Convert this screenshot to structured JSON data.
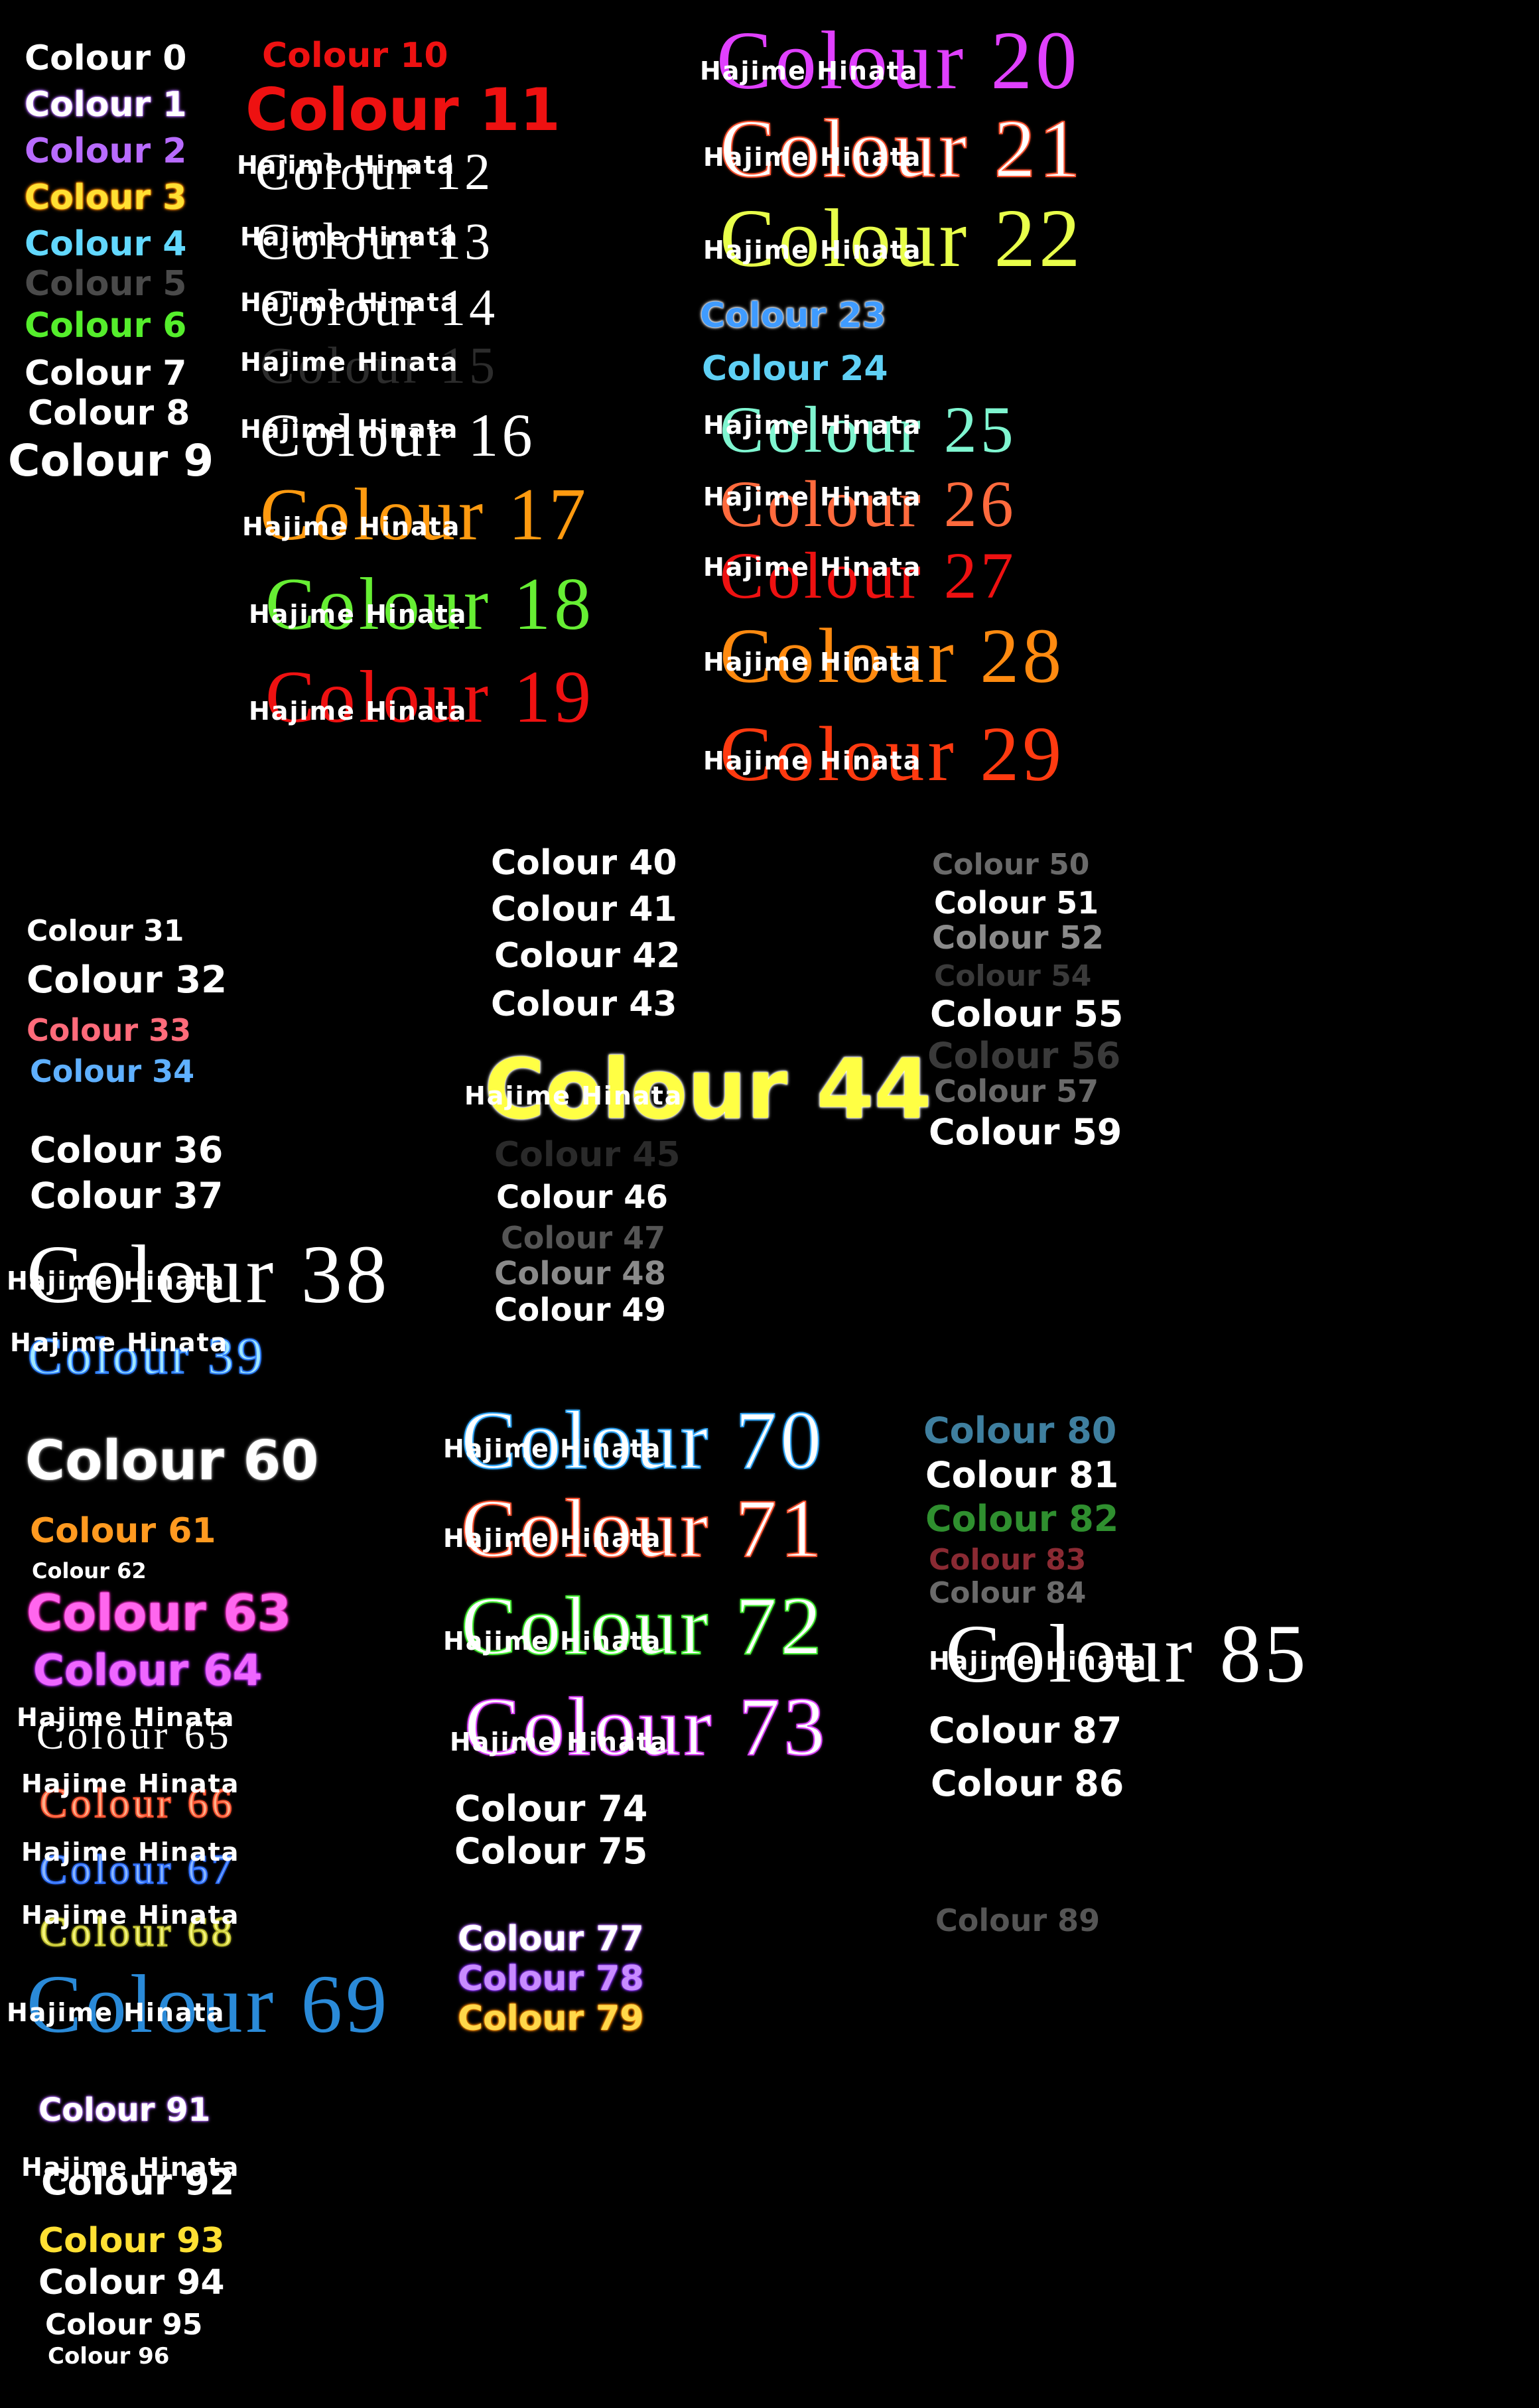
{
  "speaker": "Hajime Hinata",
  "labels": [
    {
      "text": "Colour 0",
      "color": "#ffffff",
      "effect": "plain"
    },
    {
      "text": "Colour 1",
      "color": "#ffffff",
      "effect": "glow",
      "glow": "#b46bff"
    },
    {
      "text": "Colour 2",
      "color": "#b86bff",
      "effect": "plain"
    },
    {
      "text": "Colour 3",
      "color": "#ffe033",
      "effect": "glow",
      "glow": "#ff8a00"
    },
    {
      "text": "Colour 4",
      "color": "#62d8ff",
      "effect": "plain"
    },
    {
      "text": "Colour 5",
      "color": "#4a4a4a",
      "effect": "plain"
    },
    {
      "text": "Colour 6",
      "color": "#55ee2c",
      "effect": "plain"
    },
    {
      "text": "Colour 7",
      "color": "#ffffff",
      "effect": "plain"
    },
    {
      "text": "Colour 8",
      "color": "#ffffff",
      "effect": "plain"
    },
    {
      "text": "Colour 9",
      "color": "#ffffff",
      "effect": "plain"
    },
    {
      "text": "Colour 10",
      "color": "#ee1111",
      "effect": "plain"
    },
    {
      "text": "Colour 11",
      "color": "#ee1111",
      "effect": "plain"
    },
    {
      "text": "Colour 12",
      "color": "#ffffff",
      "effect": "plain"
    },
    {
      "text": "Colour 13",
      "color": "#ffffff",
      "effect": "plain"
    },
    {
      "text": "Colour 14",
      "color": "#ffffff",
      "effect": "plain"
    },
    {
      "text": "Colour 15",
      "color": "#2c2c2c",
      "effect": "plain"
    },
    {
      "text": "Colour 16",
      "color": "#ffffff",
      "effect": "plain"
    },
    {
      "text": "Colour 17",
      "color": "#ff9a10",
      "effect": "plain"
    },
    {
      "text": "Colour 18",
      "color": "#66ee33",
      "effect": "plain"
    },
    {
      "text": "Colour 19",
      "color": "#ee1111",
      "effect": "plain"
    },
    {
      "text": "Colour 20",
      "color": "#e040ff",
      "effect": "plain"
    },
    {
      "text": "Colour 21",
      "color": "#ffffff",
      "effect": "outline",
      "glow": "#ff5533"
    },
    {
      "text": "Colour 22",
      "color": "#e8ff4a",
      "effect": "plain"
    },
    {
      "text": "Colour 23",
      "color": "#3f9bff",
      "effect": "glow",
      "glow": "#ffffff"
    },
    {
      "text": "Colour 24",
      "color": "#5fd0f5",
      "effect": "plain"
    },
    {
      "text": "Colour 25",
      "color": "#7ff5d0",
      "effect": "plain"
    },
    {
      "text": "Colour 26",
      "color": "#ff6a3d",
      "effect": "plain"
    },
    {
      "text": "Colour 27",
      "color": "#ee1111",
      "effect": "plain"
    },
    {
      "text": "Colour 28",
      "color": "#ff8a10",
      "effect": "plain"
    },
    {
      "text": "Colour 29",
      "color": "#ff3a10",
      "effect": "plain"
    },
    {
      "text": "Colour 31",
      "color": "#ffffff",
      "effect": "plain"
    },
    {
      "text": "Colour 32",
      "color": "#ffffff",
      "effect": "plain"
    },
    {
      "text": "Colour 33",
      "color": "#ff6b7a",
      "effect": "plain"
    },
    {
      "text": "Colour 34",
      "color": "#5fb0ff",
      "effect": "plain"
    },
    {
      "text": "Colour 36",
      "color": "#ffffff",
      "effect": "plain"
    },
    {
      "text": "Colour 37",
      "color": "#ffffff",
      "effect": "plain"
    },
    {
      "text": "Colour 38",
      "color": "#ffffff",
      "effect": "plain"
    },
    {
      "text": "Colour 39",
      "color": "#a0e8ff",
      "effect": "outline",
      "glow": "#2f7fff"
    },
    {
      "text": "Colour 40",
      "color": "#ffffff",
      "effect": "plain"
    },
    {
      "text": "Colour 41",
      "color": "#ffffff",
      "effect": "plain"
    },
    {
      "text": "Colour 42",
      "color": "#ffffff",
      "effect": "plain"
    },
    {
      "text": "Colour 43",
      "color": "#ffffff",
      "effect": "plain"
    },
    {
      "text": "Colour 44",
      "color": "#ffff44",
      "effect": "glow",
      "glow": "#ffffff"
    },
    {
      "text": "Colour 45",
      "color": "#2a2a2a",
      "effect": "plain"
    },
    {
      "text": "Colour 46",
      "color": "#ffffff",
      "effect": "plain"
    },
    {
      "text": "Colour 47",
      "color": "#555555",
      "effect": "plain"
    },
    {
      "text": "Colour 48",
      "color": "#8a8a8a",
      "effect": "plain"
    },
    {
      "text": "Colour 49",
      "color": "#ffffff",
      "effect": "plain"
    },
    {
      "text": "Colour 50",
      "color": "#6a6a6a",
      "effect": "plain"
    },
    {
      "text": "Colour 51",
      "color": "#ffffff",
      "effect": "plain"
    },
    {
      "text": "Colour 52",
      "color": "#8a8a8a",
      "effect": "plain"
    },
    {
      "text": "Colour 54",
      "color": "#3a3a3a",
      "effect": "plain"
    },
    {
      "text": "Colour 55",
      "color": "#ffffff",
      "effect": "plain"
    },
    {
      "text": "Colour 56",
      "color": "#3a3a3a",
      "effect": "plain"
    },
    {
      "text": "Colour 57",
      "color": "#6a6a6a",
      "effect": "plain"
    },
    {
      "text": "Colour 59",
      "color": "#ffffff",
      "effect": "plain"
    },
    {
      "text": "Colour 60",
      "color": "#ffffff",
      "effect": "glow",
      "glow": "#888888"
    },
    {
      "text": "Colour 61",
      "color": "#ff9a20",
      "effect": "plain"
    },
    {
      "text": "Colour 62",
      "color": "#ffffff",
      "effect": "plain"
    },
    {
      "text": "Colour 63",
      "color": "#ff66ee",
      "effect": "glow",
      "glow": "#ff2fd0"
    },
    {
      "text": "Colour 64",
      "color": "#ee66ff",
      "effect": "glow",
      "glow": "#c02fff"
    },
    {
      "text": "Colour 65",
      "color": "#ffffff",
      "effect": "plain"
    },
    {
      "text": "Colour 66",
      "color": "#ffb08a",
      "effect": "outline",
      "glow": "#ff5533"
    },
    {
      "text": "Colour 67",
      "color": "#8ab8ff",
      "effect": "outline",
      "glow": "#2f6fff"
    },
    {
      "text": "Colour 68",
      "color": "#f5f57a",
      "effect": "outline",
      "glow": "#c0c030"
    },
    {
      "text": "Colour 69",
      "color": "#2a8ad8",
      "effect": "plain"
    },
    {
      "text": "Colour 70",
      "color": "#ffffff",
      "effect": "outline",
      "glow": "#33aaff"
    },
    {
      "text": "Colour 71",
      "color": "#ffffff",
      "effect": "outline",
      "glow": "#ff5533"
    },
    {
      "text": "Colour 72",
      "color": "#ffffff",
      "effect": "outline",
      "glow": "#44ee33"
    },
    {
      "text": "Colour 73",
      "color": "#ffffff",
      "effect": "outline",
      "glow": "#dd44ff"
    },
    {
      "text": "Colour 74",
      "color": "#ffffff",
      "effect": "plain"
    },
    {
      "text": "Colour 75",
      "color": "#ffffff",
      "effect": "plain"
    },
    {
      "text": "Colour 77",
      "color": "#ffffff",
      "effect": "glow",
      "glow": "#b46bff"
    },
    {
      "text": "Colour 78",
      "color": "#c88bff",
      "effect": "glow",
      "glow": "#8a2fff"
    },
    {
      "text": "Colour 79",
      "color": "#ffd84a",
      "effect": "glow",
      "glow": "#ff8a00"
    },
    {
      "text": "Colour 80",
      "color": "#3f7f9f",
      "effect": "plain"
    },
    {
      "text": "Colour 81",
      "color": "#ffffff",
      "effect": "plain"
    },
    {
      "text": "Colour 82",
      "color": "#2f8f2f",
      "effect": "plain"
    },
    {
      "text": "Colour 83",
      "color": "#8a2a33",
      "effect": "plain"
    },
    {
      "text": "Colour 84",
      "color": "#6a6a6a",
      "effect": "plain"
    },
    {
      "text": "Colour 85",
      "color": "#ffffff",
      "effect": "plain"
    },
    {
      "text": "Colour 87",
      "color": "#ffffff",
      "effect": "plain"
    },
    {
      "text": "Colour 86",
      "color": "#ffffff",
      "effect": "plain"
    },
    {
      "text": "Colour 89",
      "color": "#555555",
      "effect": "plain"
    },
    {
      "text": "Colour 91",
      "color": "#ffffff",
      "effect": "glow",
      "glow": "#b46bff"
    },
    {
      "text": "Colour 92",
      "color": "#ffffff",
      "effect": "plain"
    },
    {
      "text": "Colour 93",
      "color": "#ffe033",
      "effect": "plain"
    },
    {
      "text": "Colour 94",
      "color": "#ffffff",
      "effect": "plain"
    },
    {
      "text": "Colour 95",
      "color": "#ffffff",
      "effect": "plain"
    },
    {
      "text": "Colour 96",
      "color": "#ffffff",
      "effect": "plain"
    }
  ]
}
